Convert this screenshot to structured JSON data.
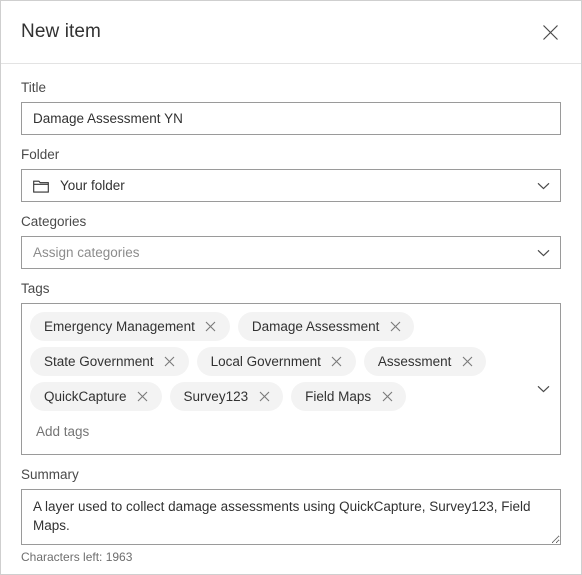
{
  "dialog": {
    "title": "New item",
    "close_icon": "close-icon"
  },
  "fields": {
    "title": {
      "label": "Title",
      "value": "Damage Assessment YN",
      "placeholder": "Title"
    },
    "folder": {
      "label": "Folder",
      "value": "Your folder",
      "icon": "folder-icon",
      "chevron": "chevron-down-icon"
    },
    "categories": {
      "label": "Categories",
      "value": "",
      "placeholder": "Assign categories",
      "chevron": "chevron-down-icon"
    },
    "tags": {
      "label": "Tags",
      "placeholder": "Add tags",
      "chevron": "chevron-down-icon",
      "items": [
        "Emergency Management",
        "Damage Assessment",
        "State Government",
        "Local Government",
        "Assessment",
        "QuickCapture",
        "Survey123",
        "Field Maps"
      ],
      "remove_icon": "close-icon"
    },
    "summary": {
      "label": "Summary",
      "value": "A layer used to collect damage assessments using QuickCapture, Survey123, Field Maps.",
      "characters_left": "Characters left: 1963"
    }
  },
  "colors": {
    "border": "#9a9a9a",
    "text": "#323232",
    "placeholder": "#8c8c8c",
    "chip_bg": "#f3f3f3"
  }
}
